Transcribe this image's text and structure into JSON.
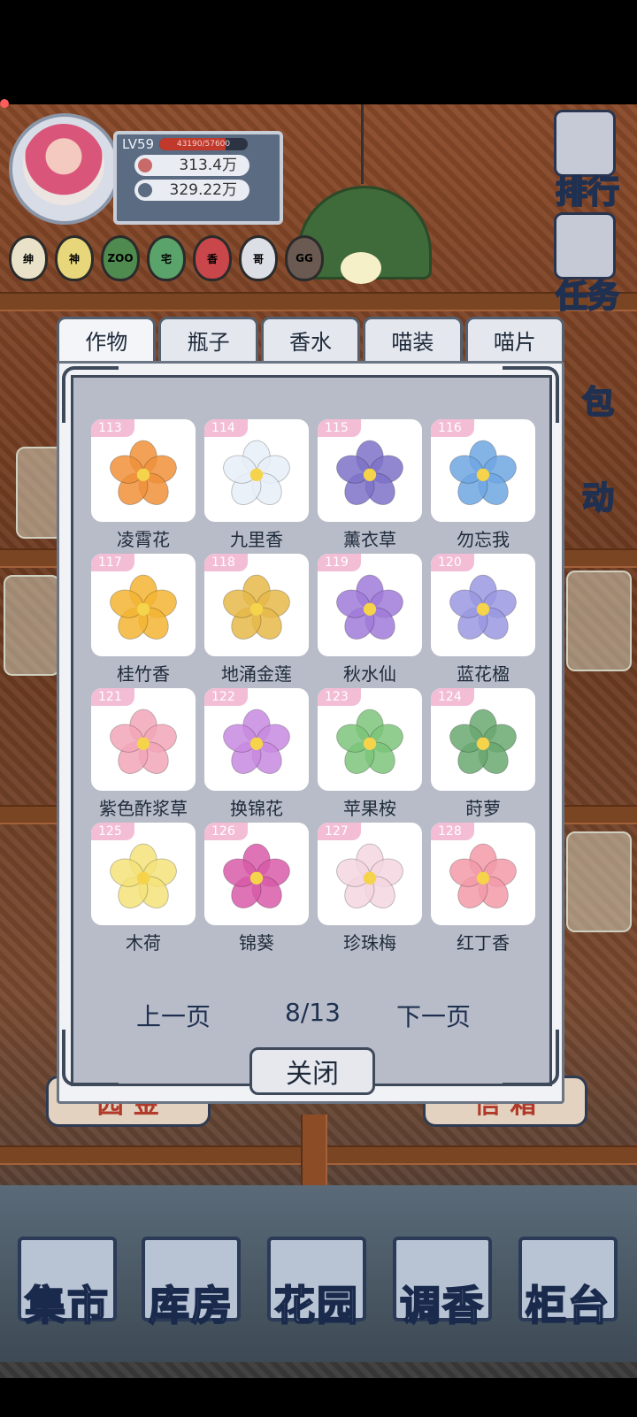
{
  "player": {
    "level": "LV59",
    "xp_text": "43190/57600",
    "xp_progress": 0.75,
    "currency_1": "313.4万",
    "currency_2": "329.22万",
    "badges": [
      {
        "label": "绅",
        "color": "#e9e2c8"
      },
      {
        "label": "神",
        "color": "#e7d77a"
      },
      {
        "label": "ZOO",
        "color": "#4f8a4f"
      },
      {
        "label": "宅",
        "color": "#5aa36a"
      },
      {
        "label": "香",
        "color": "#c9464a"
      },
      {
        "label": "哥",
        "color": "#dcdfe6"
      },
      {
        "label": "GG",
        "color": "#6a5a52"
      }
    ]
  },
  "right_menu": [
    "排行",
    "任务",
    "包",
    "动"
  ],
  "tabs": [
    "作物",
    "瓶子",
    "香水",
    "喵装",
    "喵片"
  ],
  "active_tab": "作物",
  "items": [
    {
      "num": "113",
      "name": "凌霄花",
      "color": "#f0903a"
    },
    {
      "num": "114",
      "name": "九里香",
      "color": "#e8eef8"
    },
    {
      "num": "115",
      "name": "薰衣草",
      "color": "#7c72c8"
    },
    {
      "num": "116",
      "name": "勿忘我",
      "color": "#6ea6e2"
    },
    {
      "num": "117",
      "name": "桂竹香",
      "color": "#f3b433"
    },
    {
      "num": "118",
      "name": "地涌金莲",
      "color": "#e6b84a"
    },
    {
      "num": "119",
      "name": "秋水仙",
      "color": "#a07ad8"
    },
    {
      "num": "120",
      "name": "蓝花楹",
      "color": "#9a98e0"
    },
    {
      "num": "121",
      "name": "紫色酢浆草",
      "color": "#f2a6b8"
    },
    {
      "num": "122",
      "name": "换锦花",
      "color": "#c88ae0"
    },
    {
      "num": "123",
      "name": "苹果桉",
      "color": "#7cc47a"
    },
    {
      "num": "124",
      "name": "莳萝",
      "color": "#6aa870"
    },
    {
      "num": "125",
      "name": "木荷",
      "color": "#f4e27a"
    },
    {
      "num": "126",
      "name": "锦葵",
      "color": "#d85aa8"
    },
    {
      "num": "127",
      "name": "珍珠梅",
      "color": "#f3d6e0"
    },
    {
      "num": "128",
      "name": "红丁香",
      "color": "#f29aa8"
    }
  ],
  "pagination": {
    "prev": "上一页",
    "page": "8/13",
    "next": "下一页"
  },
  "close_label": "关闭",
  "signs": {
    "left": "园 金",
    "right": "信 箱"
  },
  "bottom_nav": [
    "集市",
    "库房",
    "花园",
    "调香",
    "柜台"
  ]
}
